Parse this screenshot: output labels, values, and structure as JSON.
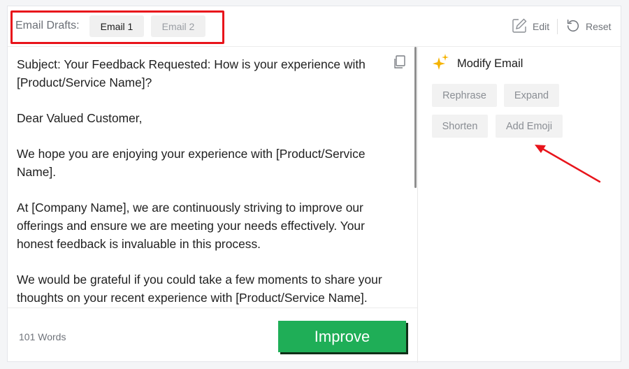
{
  "header": {
    "drafts_label": "Email Drafts:",
    "tabs": [
      {
        "label": "Email 1",
        "active": true
      },
      {
        "label": "Email 2",
        "active": false
      }
    ],
    "edit_label": "Edit",
    "reset_label": "Reset"
  },
  "email": {
    "paragraphs": [
      "Subject: Your Feedback Requested: How is your experience with [Product/Service Name]?",
      "Dear Valued Customer,",
      "We hope you are enjoying your experience with [Product/Service Name].",
      "At [Company Name], we are continuously striving to improve our offerings and ensure we are meeting your needs effectively. Your honest feedback is invaluable in this process.",
      "We would be grateful if you could take a few moments to share your thoughts on your recent experience with [Product/Service Name]."
    ]
  },
  "footer": {
    "word_count": "101 Words",
    "improve_label": "Improve"
  },
  "modify": {
    "title": "Modify Email",
    "buttons": {
      "rephrase": "Rephrase",
      "expand": "Expand",
      "shorten": "Shorten",
      "add_emoji": "Add Emoji"
    }
  },
  "colors": {
    "accent_green": "#1fae57",
    "highlight_red": "#e8141b",
    "sparkle_gold": "#f5b301"
  },
  "icons": {
    "copy": "copy-icon",
    "edit": "edit-icon",
    "reset": "reset-icon",
    "sparkle": "sparkle-icon"
  }
}
